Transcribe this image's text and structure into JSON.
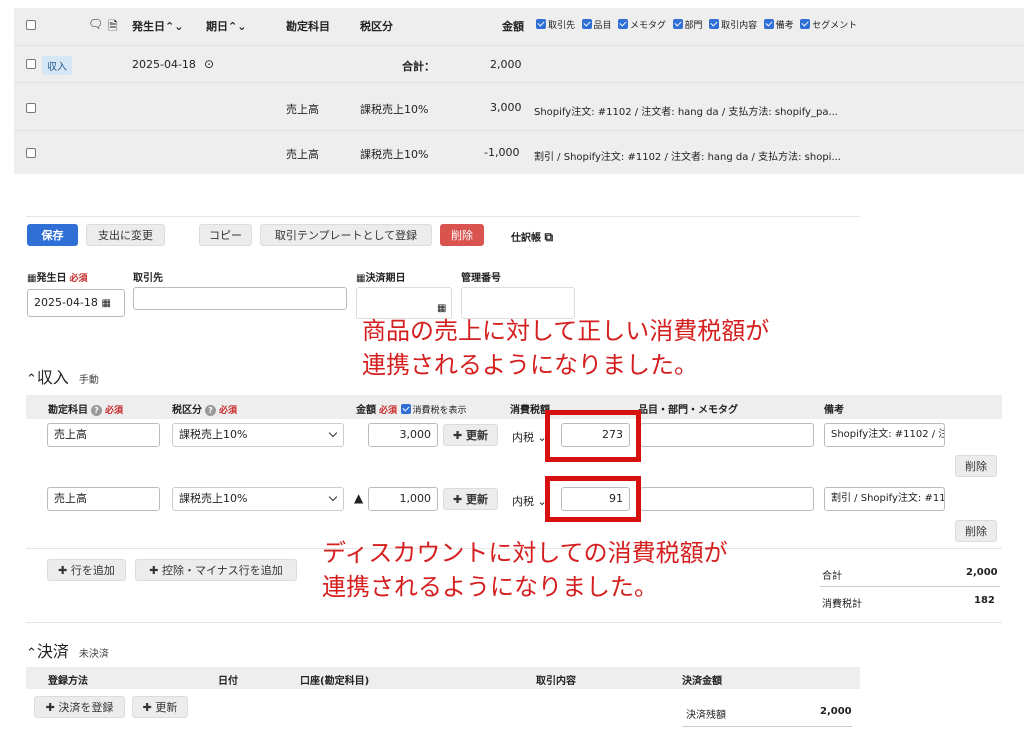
{
  "list": {
    "headers": {
      "issue_date": "発生日",
      "due_date": "期日",
      "account": "勘定科目",
      "tax": "税区分",
      "amount": "金額"
    },
    "column_toggles": [
      "取引先",
      "品目",
      "メモタグ",
      "部門",
      "取引内容",
      "備考",
      "セグメント"
    ],
    "summary_row": {
      "badge": "収入",
      "date": "2025-04-18",
      "total_label": "合計：",
      "total_value": "2,000"
    },
    "rows": [
      {
        "account": "売上高",
        "tax": "課税売上10%",
        "amount": "3,000",
        "note": "Shopify注文: #1102 / 注文者: hang da / 支払方法: shopify_pa..."
      },
      {
        "account": "売上高",
        "tax": "課税売上10%",
        "amount": "-1,000",
        "note": "割引 / Shopify注文: #1102 / 注文者: hang da / 支払方法: shopi..."
      }
    ]
  },
  "toolbar": {
    "save": "保存",
    "to_expense": "支出に変更",
    "copy": "コピー",
    "template": "取引テンプレートとして登録",
    "delete": "削除",
    "journal": "仕訳帳"
  },
  "form": {
    "issue_date_label": "発生日",
    "required": "必須",
    "partner_label": "取引先",
    "due_date_label": "決済期日",
    "mgmt_label": "管理番号",
    "issue_date_value": "2025-04-18"
  },
  "income": {
    "title": "収入",
    "sub": "手動",
    "headers": {
      "account": "勘定科目",
      "tax": "税区分",
      "amount": "金額",
      "show_tax": "消費税を表示",
      "tax_amount": "消費税額",
      "item": "品目・部門・メモタグ",
      "note": "備考"
    },
    "rows": [
      {
        "account": "売上高",
        "tax": "課税売上10%",
        "minus": "",
        "amount": "3,000",
        "update": "更新",
        "tax_mode": "内税",
        "tax_amount": "273",
        "note": "Shopify注文: #1102 / 注:",
        "delete": "削除"
      },
      {
        "account": "売上高",
        "tax": "課税売上10%",
        "minus": "▲",
        "amount": "1,000",
        "update": "更新",
        "tax_mode": "内税",
        "tax_amount": "91",
        "note": "割引 / Shopify注文: #110",
        "delete": "削除"
      }
    ],
    "add_row": "行を追加",
    "add_minus_row": "控除・マイナス行を追加",
    "totals": {
      "total_label": "合計",
      "total_value": "2,000",
      "tax_label": "消費税計",
      "tax_value": "182"
    }
  },
  "settlement": {
    "title": "決済",
    "sub": "未決済",
    "headers": {
      "method": "登録方法",
      "date": "日付",
      "account": "口座(勘定科目)",
      "content": "取引内容",
      "amount": "決済金額"
    },
    "register": "決済を登録",
    "update": "更新",
    "balance_label": "決済残額",
    "balance_value": "2,000"
  },
  "annotations": {
    "a1_line1": "商品の売上に対して正しい消費税額が",
    "a1_line2": "連携されるようになりました。",
    "a2_line1": "ディスカウントに対しての消費税額が",
    "a2_line2": "連携されるようになりました。"
  }
}
